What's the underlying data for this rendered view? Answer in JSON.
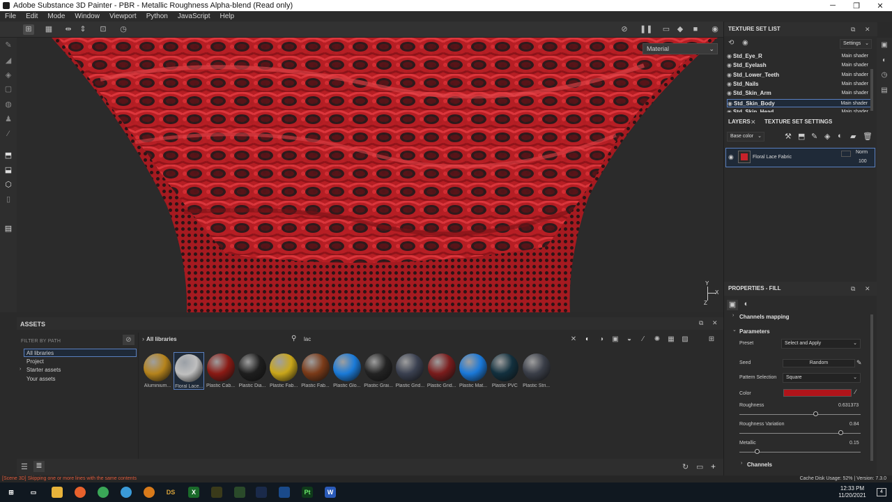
{
  "window": {
    "title": "Adobe Substance 3D Painter - PBR - Metallic Roughness Alpha-blend (Read only)",
    "minimize": "─",
    "maximize": "❐",
    "close": "✕"
  },
  "menu": [
    "File",
    "Edit",
    "Mode",
    "Window",
    "Viewport",
    "Python",
    "JavaScript",
    "Help"
  ],
  "viewport": {
    "material_dropdown": "Material",
    "axis_y": "Y",
    "axis_x": "X",
    "axis_z": "Z",
    "accent_color": "#c8222a"
  },
  "assets": {
    "title": "ASSETS",
    "filter_label": "FILTER BY PATH",
    "libraries": [
      {
        "label": "All libraries",
        "selected": true
      },
      {
        "label": "Project",
        "selected": false
      },
      {
        "label": "Starter assets",
        "selected": false,
        "expandable": true
      },
      {
        "label": "Your assets",
        "selected": false
      }
    ],
    "breadcrumb": "All libraries",
    "search_value": "lac",
    "items": [
      {
        "name": "Aluminium...",
        "color": "#b5831c"
      },
      {
        "name": "Floral Lace...",
        "color": "#bfbfbf",
        "selected": true
      },
      {
        "name": "Plastic Cab...",
        "color": "#8a1a14"
      },
      {
        "name": "Plastic Dia...",
        "color": "#1e1e1e"
      },
      {
        "name": "Plastic Fab...",
        "color": "#c9a61a"
      },
      {
        "name": "Plastic Fab...",
        "color": "#7a3a18"
      },
      {
        "name": "Plastic Glo...",
        "color": "#1a7ad8"
      },
      {
        "name": "Plastic Grai...",
        "color": "#232323"
      },
      {
        "name": "Plastic Grid...",
        "color": "#3a4050"
      },
      {
        "name": "Plastic Grid...",
        "color": "#7a1c1c"
      },
      {
        "name": "Plastic Mat...",
        "color": "#1a78d8"
      },
      {
        "name": "Plastic PVC",
        "color": "#12303e"
      },
      {
        "name": "Plastic Stri...",
        "color": "#3a3e48"
      }
    ]
  },
  "texture_set_list": {
    "title": "TEXTURE SET LIST",
    "settings_label": "Settings",
    "rows": [
      {
        "name": "Std_Eye_R",
        "shader": "Main shader"
      },
      {
        "name": "Std_Eyelash",
        "shader": "Main shader"
      },
      {
        "name": "Std_Lower_Teeth",
        "shader": "Main shader"
      },
      {
        "name": "Std_Nails",
        "shader": "Main shader"
      },
      {
        "name": "Std_Skin_Arm",
        "shader": "Main shader"
      },
      {
        "name": "Std_Skin_Body",
        "shader": "Main shader",
        "selected": true
      },
      {
        "name": "Std_Skin_Head",
        "shader": "Main shader"
      }
    ]
  },
  "layers": {
    "tab_layers": "LAYERS",
    "tab_settings": "TEXTURE SET SETTINGS",
    "channel": "Base color",
    "layer_name": "Floral Lace Fabric",
    "blend_mode": "Norm",
    "opacity": "100"
  },
  "properties": {
    "title": "PROPERTIES - FILL",
    "channels_mapping": "Channels mapping",
    "parameters": "Parameters",
    "preset_label": "Preset",
    "preset_value": "Select and Apply",
    "seed_label": "Seed",
    "seed_value": "Random",
    "pattern_label": "Pattern Selection",
    "pattern_value": "Square",
    "color_label": "Color",
    "color_value": "#b0141a",
    "roughness_label": "Roughness",
    "roughness_value": "0.631373",
    "roughness_level": 0.631373,
    "roughness_var_label": "Roughness Variation",
    "roughness_var_value": "0.84",
    "roughness_var_level": 0.84,
    "metallic_label": "Metallic",
    "metallic_value": "0.15",
    "metallic_level": 0.15,
    "channels": "Channels"
  },
  "status": {
    "message": "[Scene 3D] Skipping one or more lines with the same contents",
    "right": "Cache Disk Usage:   52%  |  Version: 7.3.0"
  },
  "taskbar": {
    "time": "12:33 PM",
    "date": "11/20/2021",
    "notifications": "4"
  }
}
